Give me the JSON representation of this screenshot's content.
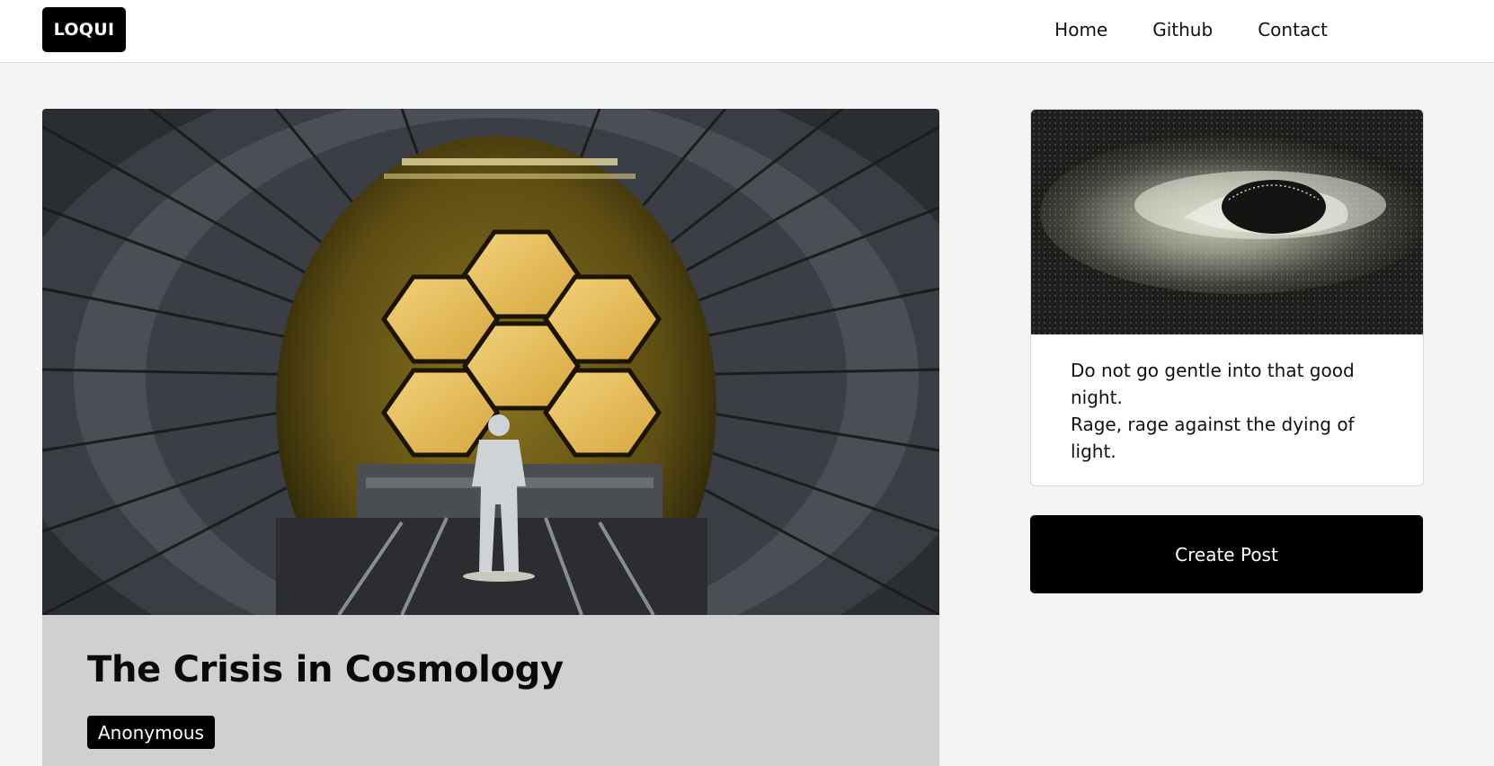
{
  "navbar": {
    "logo": "LOQUI",
    "links": [
      "Home",
      "Github",
      "Contact"
    ]
  },
  "post": {
    "title": "The Crisis in Cosmology",
    "author": "Anonymous"
  },
  "sidebar": {
    "quote_lines": [
      "Do not go gentle into that good night.",
      "Rage, rage against the dying of light."
    ],
    "create_button": "Create Post"
  },
  "colors": {
    "navbar_bg": "#ffffff",
    "page_bg": "#f4f4f4",
    "accent_black": "#000000",
    "post_body_bg": "#d0d0d0",
    "mirror_gold": "#e3b956"
  }
}
